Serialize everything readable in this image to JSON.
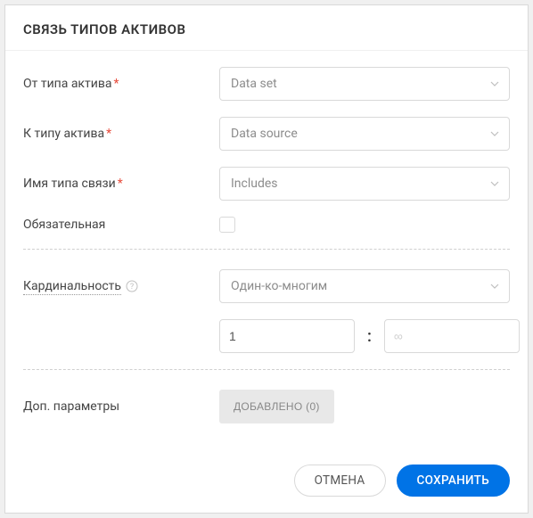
{
  "dialog": {
    "title": "СВЯЗЬ ТИПОВ АКТИВОВ"
  },
  "labels": {
    "from_type": "От типа актива",
    "to_type": "К типу актива",
    "link_name": "Имя типа связи",
    "mandatory": "Обязательная",
    "cardinality": "Кардинальность",
    "extra_params": "Доп. параметры"
  },
  "values": {
    "from_type": "Data set",
    "to_type": "Data source",
    "link_name": "Includes",
    "mandatory_checked": false,
    "cardinality": "Один-ко-многим",
    "card_min": "1",
    "card_max": "",
    "card_max_placeholder": "∞"
  },
  "extra_params": {
    "button_label": "ДОБАВЛЕНО (0)"
  },
  "footer": {
    "cancel": "ОТМЕНА",
    "save": "СОХРАНИТЬ"
  }
}
